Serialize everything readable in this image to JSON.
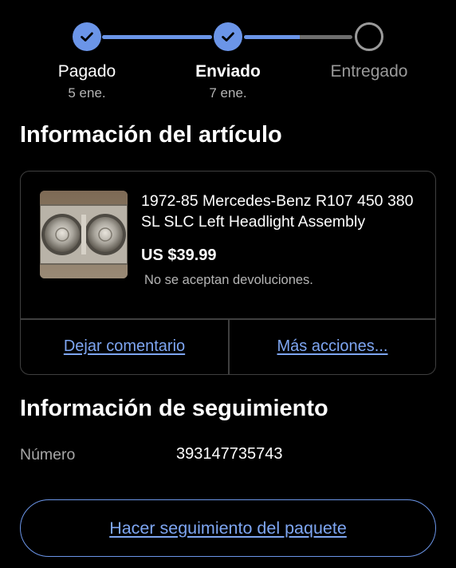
{
  "progress": {
    "steps": [
      {
        "label": "Pagado",
        "date": "5 ene.",
        "status": "done"
      },
      {
        "label": "Enviado",
        "date": "7 ene.",
        "status": "current"
      },
      {
        "label": "Entregado",
        "date": "",
        "status": "pending"
      }
    ],
    "colors": {
      "accent": "#6b95e8",
      "pending": "#9a9a9a"
    }
  },
  "item_section": {
    "title": "Información del artículo",
    "item": {
      "title": "1972-85 Mercedes-Benz R107 450 380 SL SLC Left Headlight Assembly",
      "price": "US $39.99",
      "returns": "No se aceptan devoluciones.",
      "thumbnail_icon": "headlight-photo"
    },
    "actions": {
      "feedback": "Dejar comentario",
      "more": "Más acciones..."
    }
  },
  "tracking_section": {
    "title": "Información de seguimiento",
    "number_label": "Número",
    "number_value": "393147735743",
    "button_label": "Hacer seguimiento del paquete"
  }
}
